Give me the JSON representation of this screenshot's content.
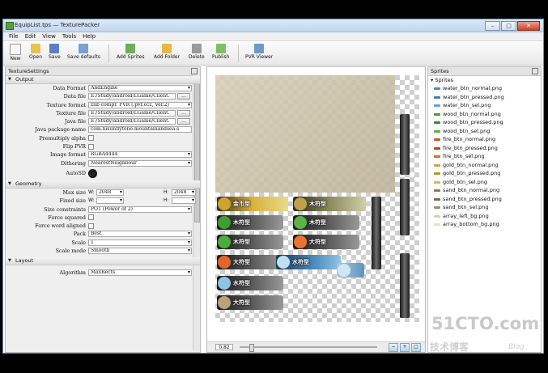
{
  "window": {
    "title": "EquipList.tps — TexturePacker",
    "min": "–",
    "max": "□",
    "close": "✕"
  },
  "menu": [
    "File",
    "Edit",
    "View",
    "Tools",
    "Help"
  ],
  "toolbar": [
    {
      "label": "New",
      "icon": "new-file-icon",
      "color": "#f4f4f4"
    },
    {
      "label": "Open",
      "icon": "open-folder-icon",
      "color": "#e8c253"
    },
    {
      "label": "Save",
      "icon": "save-disk-icon",
      "color": "#5c7fbd"
    },
    {
      "label": "Save defaults",
      "icon": "save-defaults-icon",
      "color": "#7aa0cf"
    },
    {
      "label": "Add Sprites",
      "icon": "add-sprites-icon",
      "color": "#6cae5a"
    },
    {
      "label": "Add Folder",
      "icon": "add-folder-icon",
      "color": "#e2bb4c"
    },
    {
      "label": "Delete",
      "icon": "delete-icon",
      "color": "#9a9a9a"
    },
    {
      "label": "Publish",
      "icon": "publish-icon",
      "color": "#7fbf64"
    },
    {
      "label": "PVR Viewer",
      "icon": "pvr-viewer-icon",
      "color": "#6d9ac9"
    }
  ],
  "settings": {
    "panel_title": "TextureSettings",
    "sections": {
      "output": "Output",
      "geometry": "Geometry",
      "layout": "Layout"
    },
    "output": {
      "data_format": {
        "label": "Data Format",
        "value": "AndEngine"
      },
      "data_file": {
        "label": "Data file",
        "value": "E:/Study/android/LGame/Client.",
        "btn": "..."
      },
      "texture_format": {
        "label": "Texture format",
        "value": "zlib compr. PVR (.pvr.ccz, Ver.2)"
      },
      "texture_file": {
        "label": "Texture file",
        "value": "E:/Study/android/LGame/Client.",
        "btn": "..."
      },
      "java_file": {
        "label": "Java file",
        "value": "E:/Study/android/LGame/Client.",
        "btn": "..."
      },
      "java_package": {
        "label": "Java package name",
        "value": "com.hisunflytone.mountainandsea.s"
      },
      "premultiply": {
        "label": "Premultiply alpha"
      },
      "flip_pvr": {
        "label": "Flip PVR"
      },
      "image_format": {
        "label": "Image format",
        "value": "RGBA4444"
      },
      "dithering": {
        "label": "Dithering",
        "value": "NearestNeighbour"
      },
      "autosd": {
        "label": "AutoSD"
      }
    },
    "geometry": {
      "max_size": {
        "label": "Max size",
        "w_label": "W:",
        "w": "2048",
        "h_label": "H:",
        "h": "2048"
      },
      "fixed_size": {
        "label": "Fixed size",
        "w_label": "W:",
        "w": "",
        "h_label": "H:",
        "h": ""
      },
      "size_constraints": {
        "label": "Size constraints",
        "value": "POT (Power of 2)"
      },
      "force_squared": {
        "label": "Force squared"
      },
      "force_word": {
        "label": "Force word aligned"
      },
      "pack": {
        "label": "Pack",
        "value": "Best"
      },
      "scale": {
        "label": "Scale",
        "value": "1"
      },
      "scale_mode": {
        "label": "Scale mode",
        "value": "Smooth"
      }
    },
    "layout": {
      "algorithm": {
        "label": "Algorithm",
        "value": "MaxRects"
      }
    }
  },
  "canvas": {
    "zoom": "0.82",
    "sprite_labels": [
      "金币型",
      "木符型",
      "木符型",
      "大符型",
      "水符型",
      "木符型",
      "木符型",
      "大符型",
      "水符型",
      "大符型"
    ]
  },
  "sprites_panel": {
    "title": "Sprites",
    "root": "Sprites",
    "items": [
      {
        "name": "water_btn_normal.png",
        "color": "#4d8fc2"
      },
      {
        "name": "water_btn_pressed.png",
        "color": "#3f7eb3"
      },
      {
        "name": "water_btn_sel.png",
        "color": "#5fa1d2"
      },
      {
        "name": "wood_btn_normal.png",
        "color": "#4f9a3c"
      },
      {
        "name": "wood_btn_pressed.png",
        "color": "#3f8a2e"
      },
      {
        "name": "wood_btn_sel.png",
        "color": "#64ad4f"
      },
      {
        "name": "fire_btn_normal.png",
        "color": "#c9532a"
      },
      {
        "name": "fire_btn_pressed.png",
        "color": "#b5431f"
      },
      {
        "name": "fire_btn_sel.png",
        "color": "#d9683a"
      },
      {
        "name": "gold_btn_normal.png",
        "color": "#c9a53a"
      },
      {
        "name": "gold_btn_pressed.png",
        "color": "#b8942c"
      },
      {
        "name": "gold_btn_sel.png",
        "color": "#dcb84b"
      },
      {
        "name": "sand_btn_normal.png",
        "color": "#8a7a5a"
      },
      {
        "name": "sand_btn_pressed.png",
        "color": "#786a4c"
      },
      {
        "name": "sand_btn_sel.png",
        "color": "#9c8c6a"
      },
      {
        "name": "array_left_bg.png",
        "color": "#d8cfb8"
      },
      {
        "name": "array_bottom_bg.png",
        "color": "#e6dfcc"
      }
    ]
  },
  "watermark": {
    "line1": "51CTO.com",
    "line2": "技术博客",
    "line3": "Blog"
  }
}
